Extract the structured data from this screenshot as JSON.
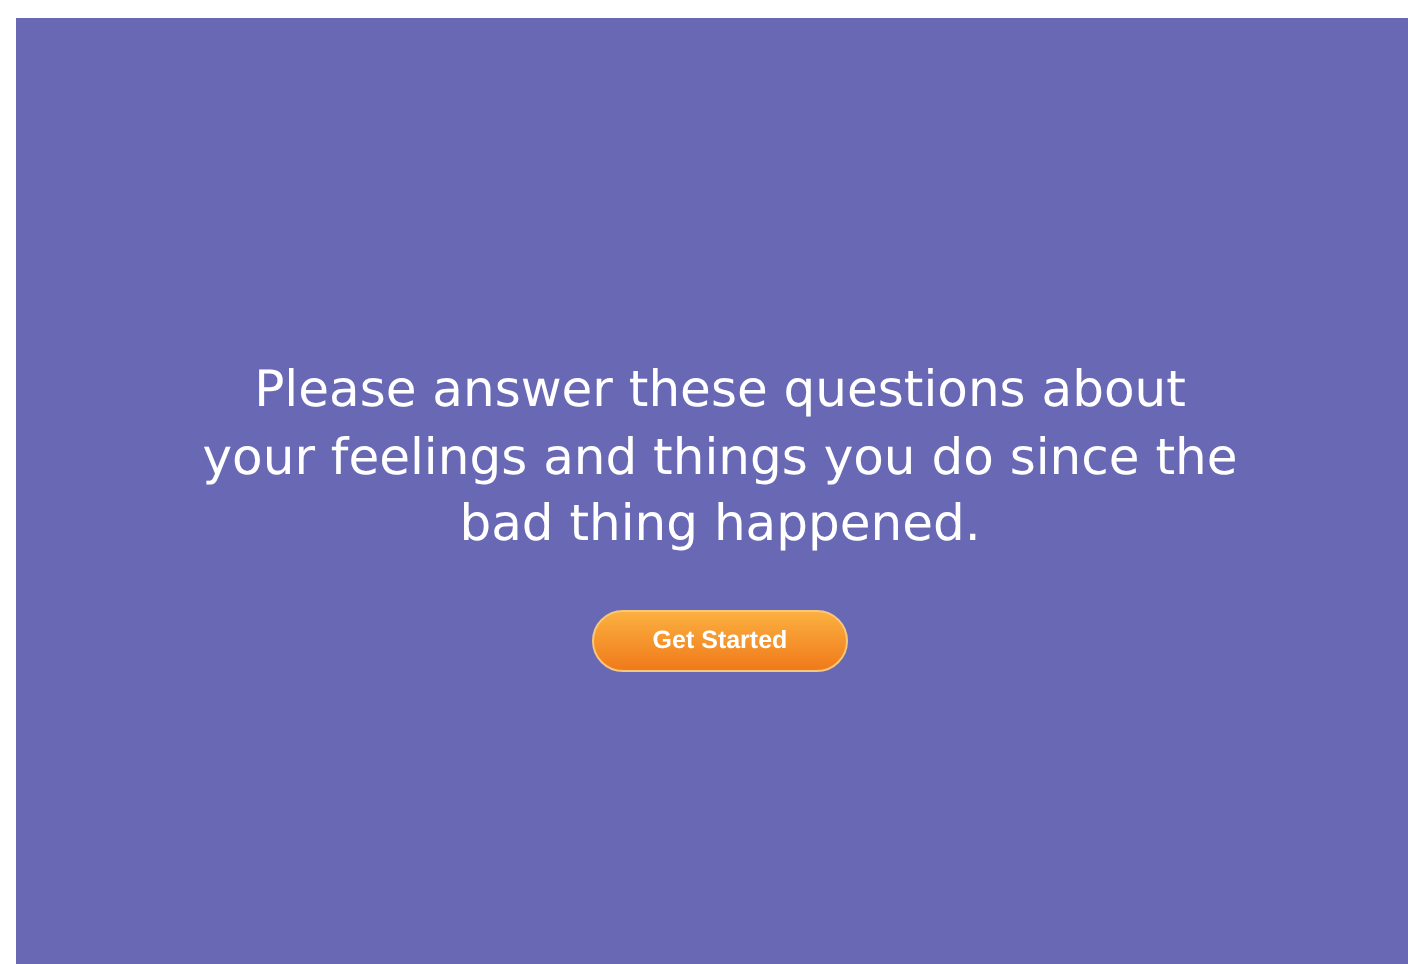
{
  "message": "Please answer these questions about your feelings and things you do since the bad thing happened.",
  "button": {
    "label": "Get Started"
  }
}
